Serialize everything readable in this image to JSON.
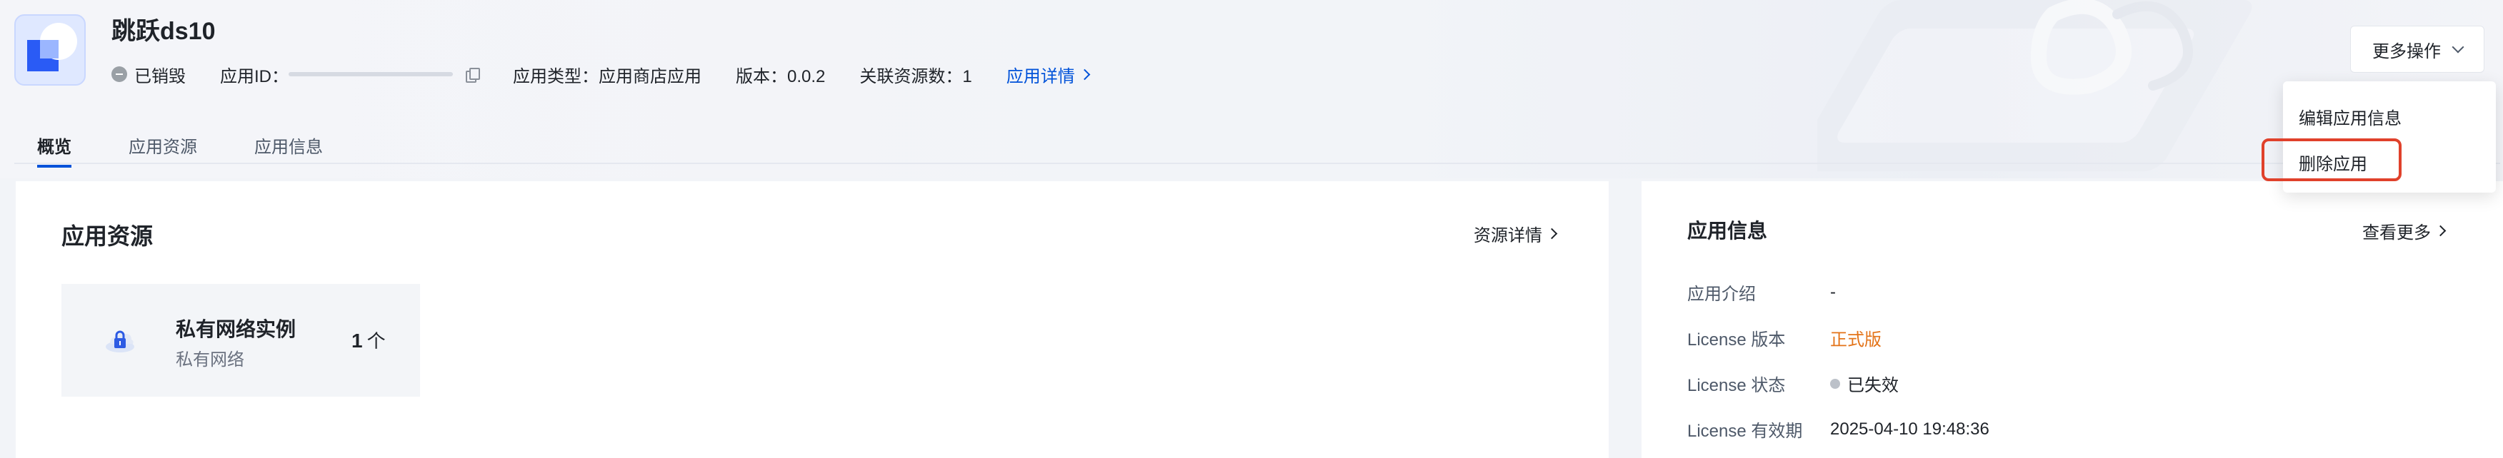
{
  "header": {
    "app_name": "跳跃ds10",
    "more_actions_label": "更多操作"
  },
  "meta": {
    "status": "已销毁",
    "app_id_label": "应用ID：",
    "app_type": "应用类型：应用商店应用",
    "version": "版本：0.0.2",
    "related_resources": "关联资源数：1",
    "details_link": "应用详情"
  },
  "tabs": [
    {
      "label": "概览",
      "active": true
    },
    {
      "label": "应用资源",
      "active": false
    },
    {
      "label": "应用信息",
      "active": false
    }
  ],
  "dropdown": {
    "items": [
      "编辑应用信息",
      "删除应用"
    ],
    "highlighted": "删除应用",
    "highlight_color": "#e0412b"
  },
  "resources_card": {
    "title": "应用资源",
    "link": "资源详情",
    "tile": {
      "name": "私有网络实例",
      "subtitle": "私有网络",
      "count": "1",
      "unit": "个",
      "icon": "cloud-lock-icon"
    }
  },
  "info_card": {
    "title": "应用信息",
    "link": "查看更多",
    "rows": [
      {
        "label": "应用介绍",
        "value": "-"
      },
      {
        "label": "License 版本",
        "value": "正式版"
      },
      {
        "label": "License 状态",
        "value": "已失效"
      },
      {
        "label": "License 有效期",
        "value": "2025-04-10 19:48:36"
      }
    ]
  },
  "colors": {
    "accent": "#0052d9",
    "license_version": "#e37318",
    "status_grey": "#9aa0a6"
  }
}
